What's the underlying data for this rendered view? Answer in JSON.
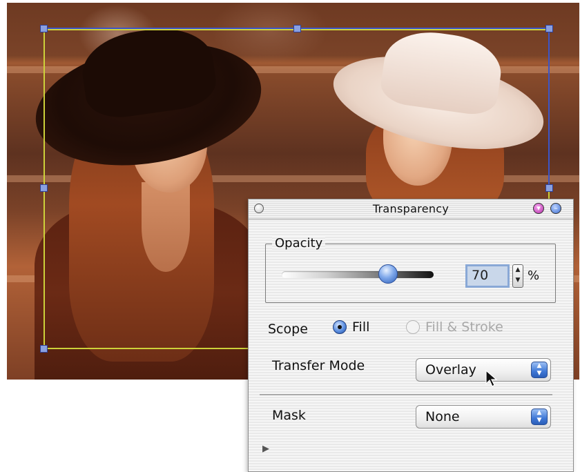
{
  "palette": {
    "title": "Transparency",
    "opacity": {
      "group_label": "Opacity",
      "slider_value_percent": 70,
      "value": "70",
      "unit": "%"
    },
    "scope": {
      "label": "Scope",
      "options": [
        {
          "label": "Fill",
          "selected": true,
          "enabled": true
        },
        {
          "label": "Fill & Stroke",
          "selected": false,
          "enabled": false
        }
      ]
    },
    "transfer_mode": {
      "label": "Transfer Mode",
      "selected": "Overlay"
    },
    "mask": {
      "label": "Mask",
      "selected": "None"
    }
  },
  "colors": {
    "frame_yellow": "#cdd23a",
    "frame_blue": "#3b55c9",
    "accent_blue": "#3f78d6",
    "photo_tone": "sepia"
  },
  "icons": {
    "close": "close-icon",
    "zoom": "zoom-icon",
    "collapse": "collapse-icon",
    "stepper": "stepper-icon",
    "popup_arrows": "popup-arrows-icon",
    "disclosure": "disclosure-triangle-icon",
    "cursor": "mouse-pointer-icon"
  }
}
